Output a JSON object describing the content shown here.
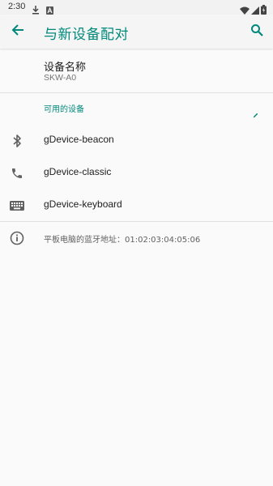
{
  "status_bar": {
    "time": "2:30",
    "icons": [
      "download-icon",
      "a-icon",
      "wifi-icon",
      "signal-icon",
      "battery-icon"
    ]
  },
  "app_bar": {
    "title": "与新设备配对",
    "back_icon": "arrow-back-icon",
    "search_icon": "search-icon",
    "accent_color": "#00897b"
  },
  "device_name": {
    "label": "设备名称",
    "value": "SKW-A0"
  },
  "available_devices": {
    "header": "可用的设备",
    "items": [
      {
        "icon": "bluetooth-icon",
        "label": "gDevice-beacon"
      },
      {
        "icon": "phone-icon",
        "label": "gDevice-classic"
      },
      {
        "icon": "keyboard-icon",
        "label": "gDevice-keyboard"
      }
    ]
  },
  "info": {
    "icon": "info-icon",
    "text": "平板电脑的蓝牙地址：01:02:03:04:05:06"
  }
}
